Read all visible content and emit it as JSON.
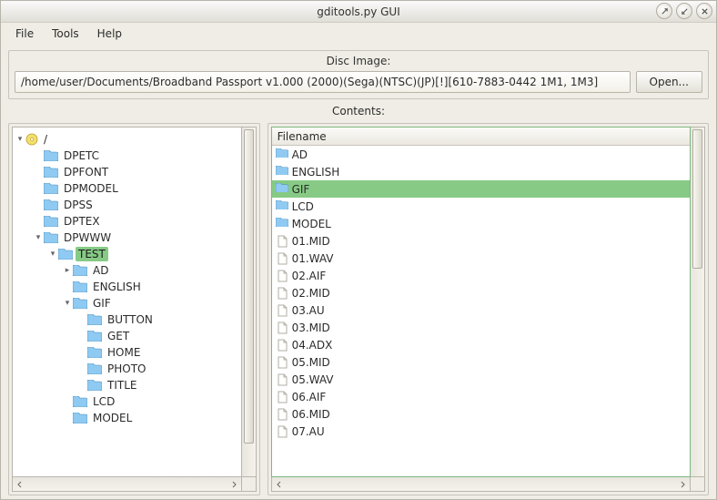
{
  "window": {
    "title": "gditools.py GUI"
  },
  "menu": {
    "file": "File",
    "tools": "Tools",
    "help": "Help"
  },
  "disc": {
    "label": "Disc Image:",
    "path": "/home/user/Documents/Broadband Passport v1.000 (2000)(Sega)(NTSC)(JP)[!][610-7883-0442 1M1, 1M3]",
    "open": "Open..."
  },
  "contents_label": "Contents:",
  "tree": {
    "root": "/",
    "items": [
      {
        "d": 1,
        "exp": "",
        "label": "DPETC"
      },
      {
        "d": 1,
        "exp": "",
        "label": "DPFONT"
      },
      {
        "d": 1,
        "exp": "",
        "label": "DPMODEL"
      },
      {
        "d": 1,
        "exp": "",
        "label": "DPSS"
      },
      {
        "d": 1,
        "exp": "",
        "label": "DPTEX"
      },
      {
        "d": 1,
        "exp": "v",
        "label": "DPWWW"
      },
      {
        "d": 2,
        "exp": "v",
        "label": "TEST",
        "selected": true
      },
      {
        "d": 3,
        "exp": ">",
        "label": "AD"
      },
      {
        "d": 3,
        "exp": "",
        "label": "ENGLISH"
      },
      {
        "d": 3,
        "exp": "v",
        "label": "GIF"
      },
      {
        "d": 4,
        "exp": "",
        "label": "BUTTON"
      },
      {
        "d": 4,
        "exp": "",
        "label": "GET"
      },
      {
        "d": 4,
        "exp": "",
        "label": "HOME"
      },
      {
        "d": 4,
        "exp": "",
        "label": "PHOTO"
      },
      {
        "d": 4,
        "exp": "",
        "label": "TITLE"
      },
      {
        "d": 3,
        "exp": "",
        "label": "LCD"
      },
      {
        "d": 3,
        "exp": "",
        "label": "MODEL"
      }
    ]
  },
  "list": {
    "header": "Filename",
    "rows": [
      {
        "type": "folder",
        "name": "AD"
      },
      {
        "type": "folder",
        "name": "ENGLISH"
      },
      {
        "type": "folder",
        "name": "GIF",
        "selected": true
      },
      {
        "type": "folder",
        "name": "LCD"
      },
      {
        "type": "folder",
        "name": "MODEL"
      },
      {
        "type": "file",
        "name": "01.MID"
      },
      {
        "type": "file",
        "name": "01.WAV"
      },
      {
        "type": "file",
        "name": "02.AIF"
      },
      {
        "type": "file",
        "name": "02.MID"
      },
      {
        "type": "file",
        "name": "03.AU"
      },
      {
        "type": "file",
        "name": "03.MID"
      },
      {
        "type": "file",
        "name": "04.ADX"
      },
      {
        "type": "file",
        "name": "05.MID"
      },
      {
        "type": "file",
        "name": "05.WAV"
      },
      {
        "type": "file",
        "name": "06.AIF"
      },
      {
        "type": "file",
        "name": "06.MID"
      },
      {
        "type": "file",
        "name": "07.AU"
      }
    ]
  }
}
